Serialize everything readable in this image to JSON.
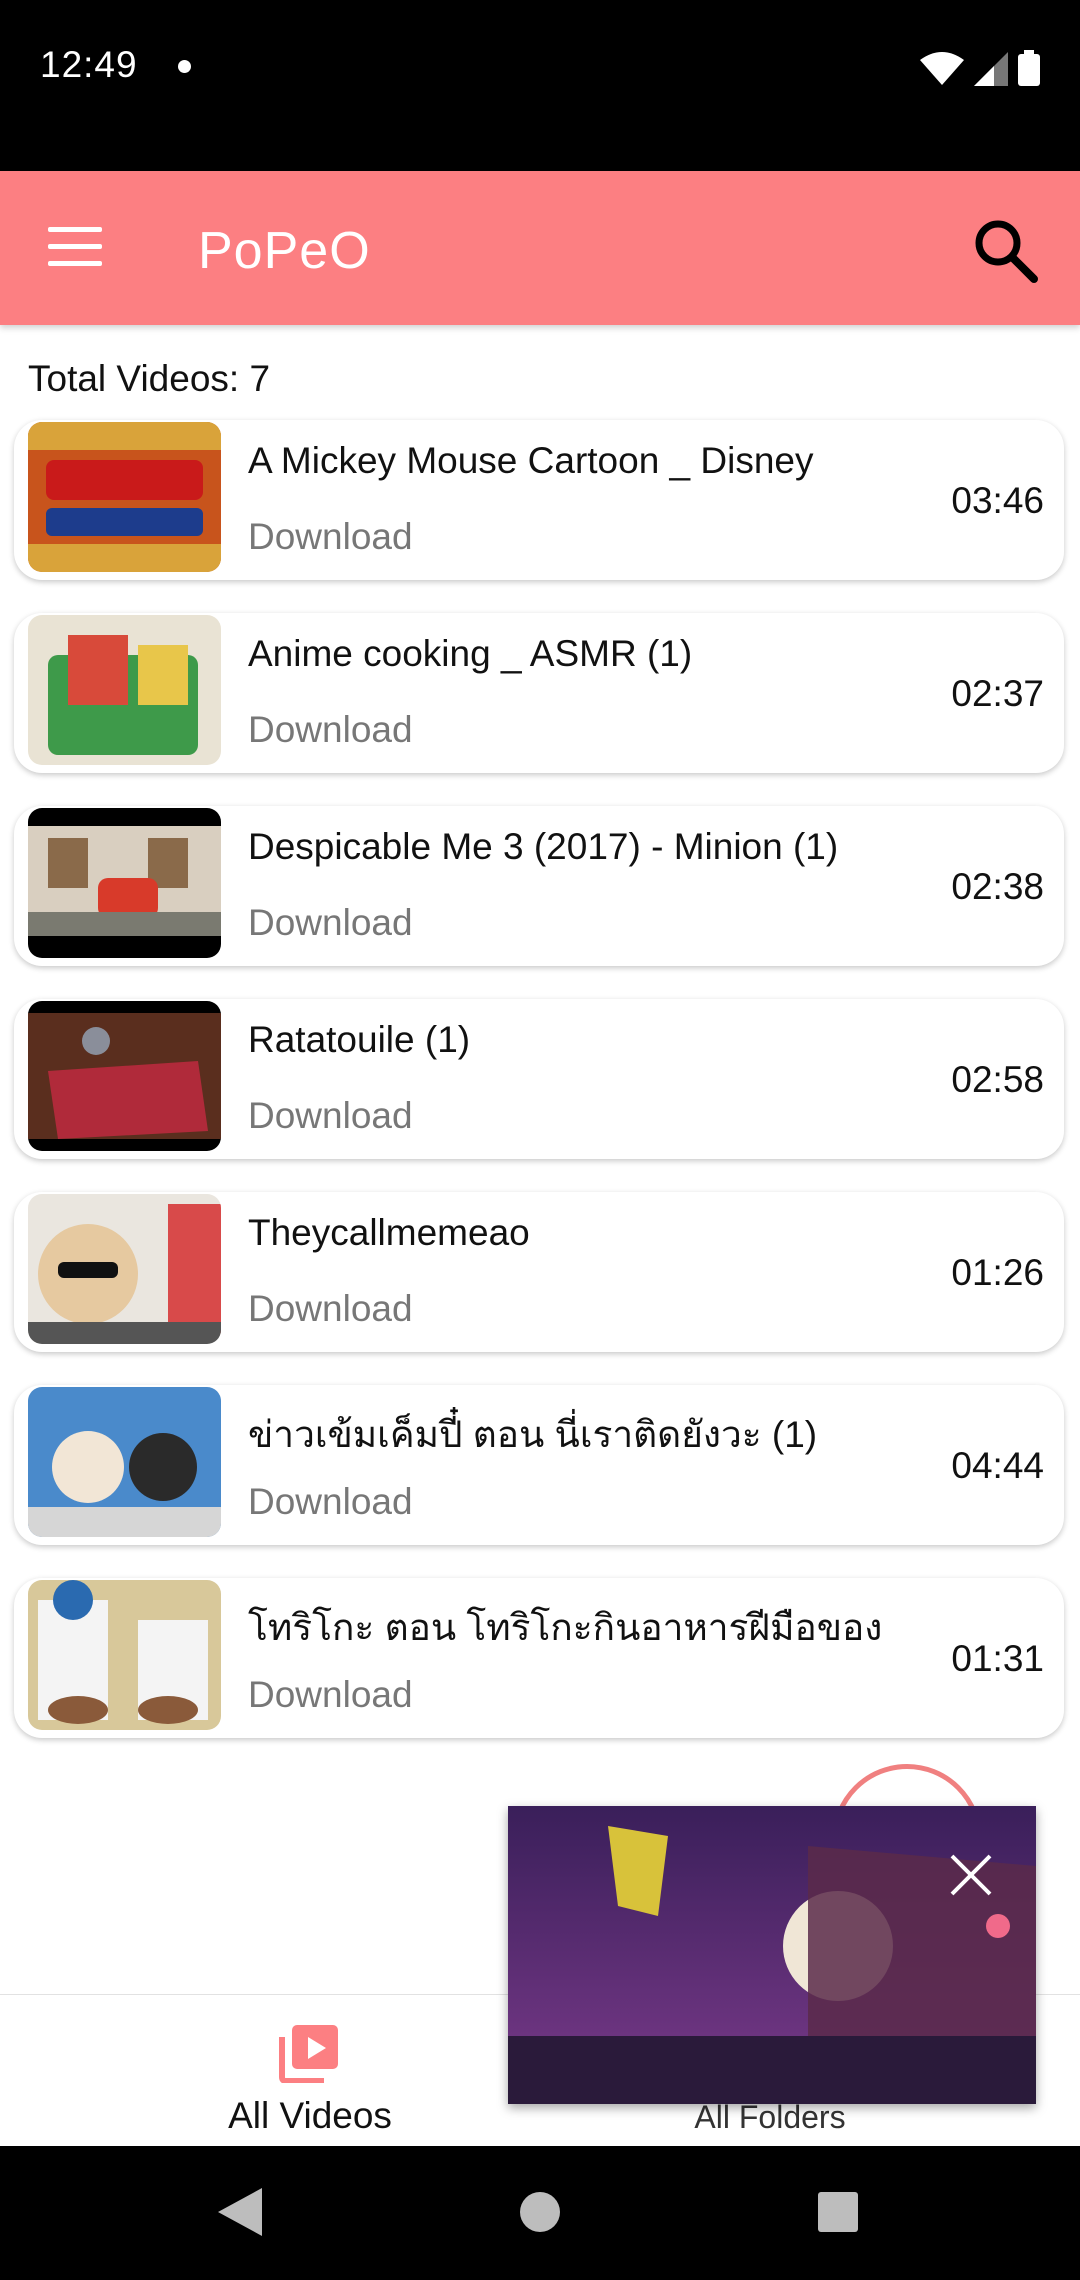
{
  "status_bar": {
    "time": "12:49"
  },
  "app_bar": {
    "title": "PoPeO",
    "menu_icon": "menu-icon",
    "search_icon": "search-icon"
  },
  "summary": {
    "total_label": "Total Videos: 7"
  },
  "videos": [
    {
      "title": "A Mickey Mouse Cartoon _ Disney",
      "action": "Download",
      "duration": "03:46"
    },
    {
      "title": "Anime cooking _ ASMR (1)",
      "action": "Download",
      "duration": "02:37"
    },
    {
      "title": "Despicable Me 3 (2017) - Minion (1)",
      "action": "Download",
      "duration": "02:38"
    },
    {
      "title": "Ratatouile (1)",
      "action": "Download",
      "duration": "02:58"
    },
    {
      "title": "Theycallmemeao",
      "action": "Download",
      "duration": "01:26"
    },
    {
      "title": "ข่าวเข้มเค็มปี๋ ตอน นี่เราติดยังวะ (1)",
      "action": "Download",
      "duration": "04:44"
    },
    {
      "title": "โทริโกะ ตอน โทริโกะกินอาหารฝีมือของ",
      "action": "Download",
      "duration": "01:31"
    }
  ],
  "bottom_nav": {
    "all_videos": "All Videos",
    "all_folders": "All Folders"
  },
  "colors": {
    "accent": "#fc7f82"
  }
}
